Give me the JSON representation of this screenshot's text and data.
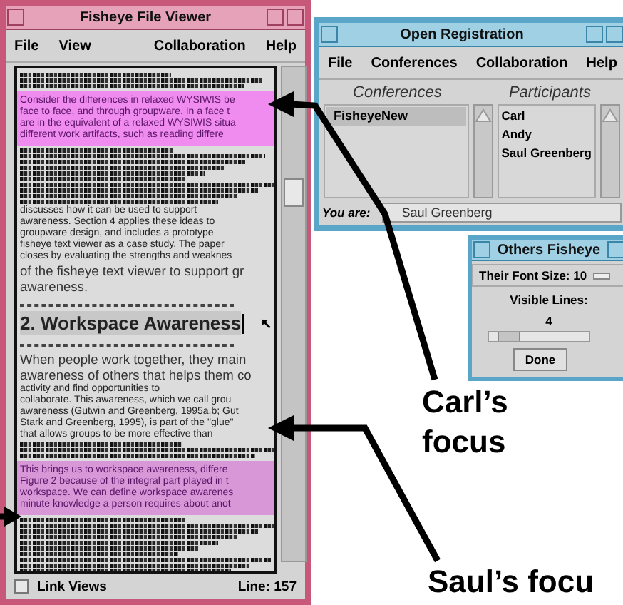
{
  "fisheye_viewer": {
    "title": "Fisheye File Viewer",
    "menu": [
      "File",
      "View",
      "Collaboration",
      "Help"
    ],
    "blocks": [
      {
        "kind": "compressed"
      },
      {
        "kind": "highlight",
        "color": "#f08cf0",
        "lines": [
          "Consider the differences in relaxed WYSIWIS be",
          "face to face, and through groupware. In a face t",
          "are in the equivalent of a relaxed WYSIWIS situa",
          "different work artifacts, such as reading differe"
        ]
      },
      {
        "kind": "compressed"
      },
      {
        "kind": "smalltext",
        "lines": [
          "discusses how it can be used to support",
          "awareness. Section 4 applies these ideas to",
          "groupware design, and includes a prototype",
          "fisheye text viewer as a case study. The paper",
          "closes by evaluating the strengths and weaknes"
        ]
      },
      {
        "kind": "text",
        "lines": [
          "of the fisheye text viewer to support gr",
          "awareness."
        ]
      },
      {
        "kind": "divider"
      },
      {
        "kind": "heading",
        "text": "2. Workspace Awareness"
      },
      {
        "kind": "divider"
      },
      {
        "kind": "text",
        "lines": [
          "When people work together, they main",
          "awareness of others that helps them co"
        ]
      },
      {
        "kind": "smalltext",
        "lines": [
          "activity and find opportunities to",
          "collaborate. This awareness, which we call grou",
          "awareness (Gutwin and Greenberg, 1995a,b; Gut",
          "Stark and Greenberg, 1995), is part of the \"glue\"",
          "that allows groups to be more effective than"
        ]
      },
      {
        "kind": "compressed"
      },
      {
        "kind": "highlight",
        "color": "#d898d8",
        "lines": [
          "This brings us to workspace awareness, differe",
          "Figure 2 because of the integral part played in t",
          "workspace. We can define workspace awarenes",
          "minute knowledge a person requires about anot"
        ]
      },
      {
        "kind": "compressed"
      }
    ],
    "link_views": {
      "label": "Link Views",
      "checked": false
    },
    "line_status": "Line: 157"
  },
  "open_registration": {
    "title": "Open Registration",
    "menu": [
      "File",
      "Conferences",
      "Collaboration",
      "Help"
    ],
    "conferences_heading": "Conferences",
    "participants_heading": "Participants",
    "conferences": [
      {
        "name": "FisheyeNew",
        "selected": true
      }
    ],
    "participants": [
      "Carl",
      "Andy",
      "Saul Greenberg"
    ],
    "you_are_label": "You are:",
    "you_are_value": "Saul Greenberg"
  },
  "others_fisheye": {
    "title": "Others Fisheye",
    "font_size_label": "Their Font Size: 10",
    "visible_lines_label": "Visible Lines:",
    "visible_lines_value": "4",
    "slider": {
      "level": 0.2
    },
    "done_button": "Done"
  },
  "annotations": [
    {
      "text": "Carl’s focus"
    },
    {
      "text": "Saul’s focu"
    }
  ]
}
